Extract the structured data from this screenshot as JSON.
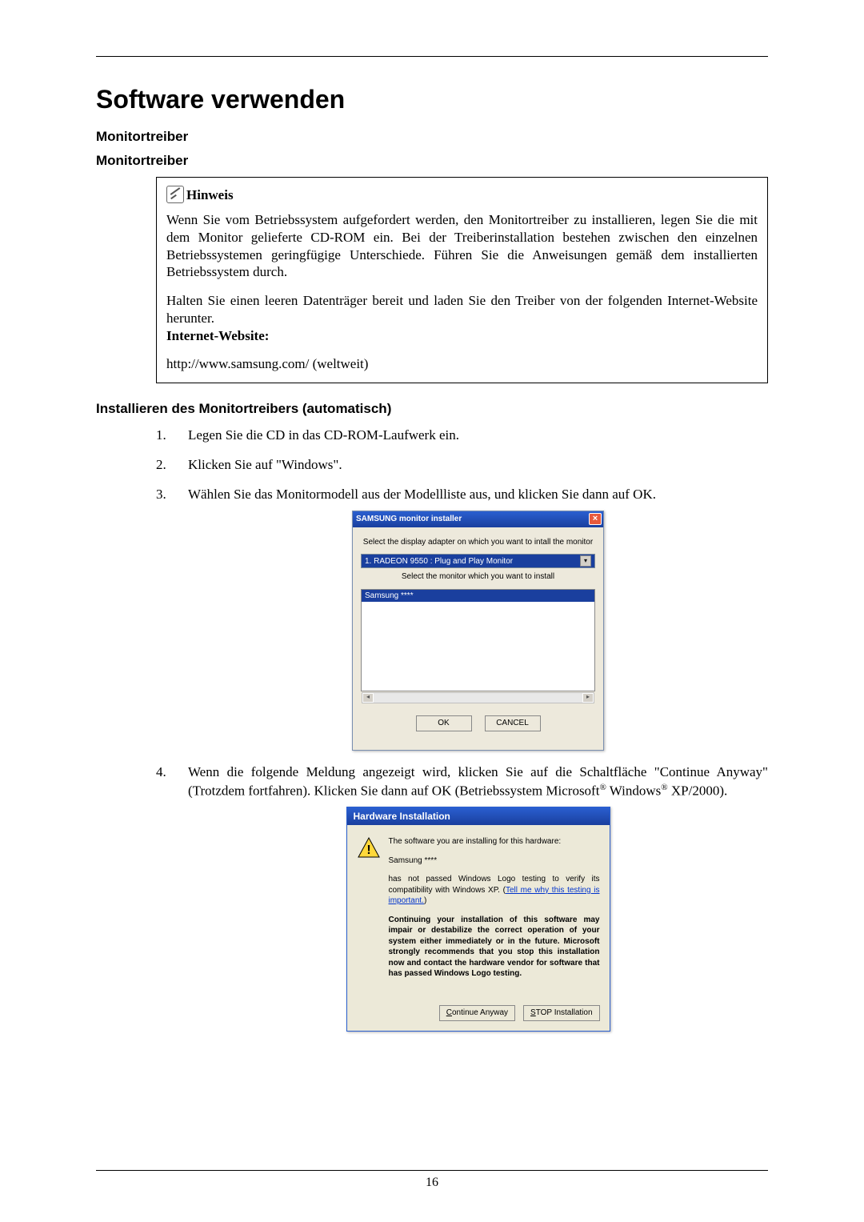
{
  "title": "Software verwenden",
  "section1": "Monitortreiber",
  "section2": "Monitortreiber",
  "note": {
    "heading": "Hinweis",
    "p1": "Wenn Sie vom Betriebssystem aufgefordert werden, den Monitortreiber zu installieren, legen Sie die mit dem Monitor gelieferte CD-ROM ein. Bei der Treiberinstallation bestehen zwischen den einzelnen Betriebssystemen geringfügige Unterschiede. Führen Sie die Anweisungen gemäß dem installierten Betriebssystem durch.",
    "p2": "Halten Sie einen leeren Datenträger bereit und laden Sie den Treiber von der folgenden Internet-Website herunter.",
    "websiteLabel": "Internet-Website:",
    "url": "http://www.samsung.com/ (weltweit)"
  },
  "section3": "Installieren des Monitortreibers (automatisch)",
  "steps": {
    "s1": "Legen Sie die CD in das CD-ROM-Laufwerk ein.",
    "s2": "Klicken Sie auf \"Windows\".",
    "s3": "Wählen Sie das Monitormodell aus der Modellliste aus, und klicken Sie dann auf OK.",
    "s4a": "Wenn die folgende Meldung angezeigt wird, klicken Sie auf die Schaltfläche \"Continue Anyway\" (Trotzdem fortfahren). Klicken Sie dann auf OK (Betriebssystem Microsoft",
    "s4b": " Windows",
    "s4c": " XP/2000)."
  },
  "installer": {
    "title": "SAMSUNG monitor installer",
    "label1": "Select the display adapter on which you want to intall the monitor",
    "adapter": "1. RADEON 9550 : Plug and Play Monitor",
    "label2": "Select the monitor which you want to install",
    "monitor": "Samsung ****",
    "ok": "OK",
    "cancel": "CANCEL"
  },
  "hwdlg": {
    "title": "Hardware Installation",
    "p1": "The software you are installing for this hardware:",
    "p2": "Samsung ****",
    "p3a": "has not passed Windows Logo testing to verify its compatibility with Windows XP. (",
    "p3link": "Tell me why this testing is important.",
    "p3b": ")",
    "p4": "Continuing your installation of this software may impair or destabilize the correct operation of your system either immediately or in the future. Microsoft strongly recommends that you stop this installation now and contact the hardware vendor for software that has passed Windows Logo testing.",
    "btnContinue": "Continue Anyway",
    "btnStop": "STOP Installation",
    "cUnderline": "C",
    "sUnderline": "S"
  },
  "pageNumber": "16"
}
